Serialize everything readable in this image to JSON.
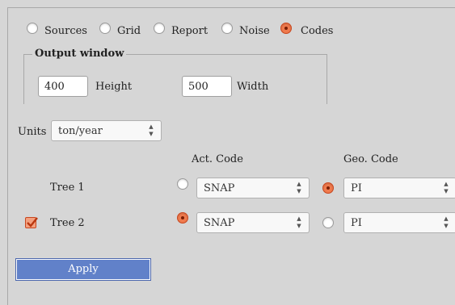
{
  "tabs": {
    "sources": "Sources",
    "grid": "Grid",
    "report": "Report",
    "noise": "Noise",
    "codes": "Codes",
    "selected": "Codes"
  },
  "output_window": {
    "title": "Output window",
    "height_value": "400",
    "height_label": "Height",
    "width_value": "500",
    "width_label": "Width"
  },
  "units": {
    "label": "Units",
    "value": "ton/year"
  },
  "columns": {
    "act_code": "Act. Code",
    "geo_code": "Geo. Code"
  },
  "rows": [
    {
      "label": "Tree 1",
      "checked": false,
      "act_selected": false,
      "act_value": "SNAP",
      "geo_selected": true,
      "geo_value": "PI"
    },
    {
      "label": "Tree 2",
      "checked": true,
      "act_selected": true,
      "act_value": "SNAP",
      "geo_selected": false,
      "geo_value": "PI"
    }
  ],
  "apply_label": "Apply",
  "colors": {
    "accent": "#f07b4e",
    "button": "#6181c9",
    "background": "#d6d6d6"
  }
}
